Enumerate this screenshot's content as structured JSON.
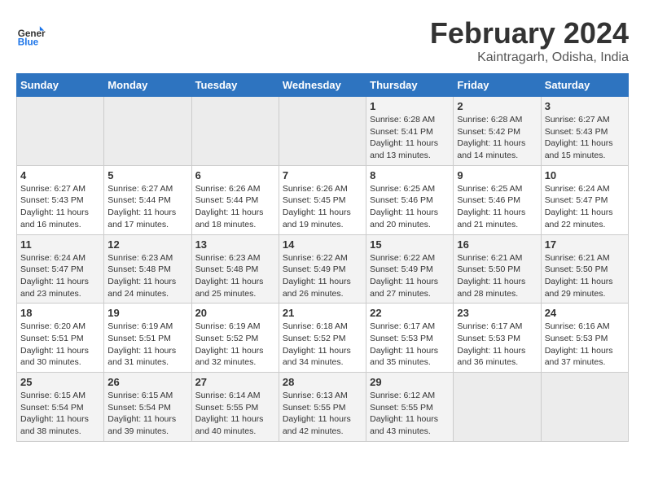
{
  "header": {
    "logo_line1": "General",
    "logo_line2": "Blue",
    "month": "February 2024",
    "location": "Kaintragarh, Odisha, India"
  },
  "days_of_week": [
    "Sunday",
    "Monday",
    "Tuesday",
    "Wednesday",
    "Thursday",
    "Friday",
    "Saturday"
  ],
  "weeks": [
    [
      {
        "day": "",
        "info": ""
      },
      {
        "day": "",
        "info": ""
      },
      {
        "day": "",
        "info": ""
      },
      {
        "day": "",
        "info": ""
      },
      {
        "day": "1",
        "info": "Sunrise: 6:28 AM\nSunset: 5:41 PM\nDaylight: 11 hours and 13 minutes."
      },
      {
        "day": "2",
        "info": "Sunrise: 6:28 AM\nSunset: 5:42 PM\nDaylight: 11 hours and 14 minutes."
      },
      {
        "day": "3",
        "info": "Sunrise: 6:27 AM\nSunset: 5:43 PM\nDaylight: 11 hours and 15 minutes."
      }
    ],
    [
      {
        "day": "4",
        "info": "Sunrise: 6:27 AM\nSunset: 5:43 PM\nDaylight: 11 hours and 16 minutes."
      },
      {
        "day": "5",
        "info": "Sunrise: 6:27 AM\nSunset: 5:44 PM\nDaylight: 11 hours and 17 minutes."
      },
      {
        "day": "6",
        "info": "Sunrise: 6:26 AM\nSunset: 5:44 PM\nDaylight: 11 hours and 18 minutes."
      },
      {
        "day": "7",
        "info": "Sunrise: 6:26 AM\nSunset: 5:45 PM\nDaylight: 11 hours and 19 minutes."
      },
      {
        "day": "8",
        "info": "Sunrise: 6:25 AM\nSunset: 5:46 PM\nDaylight: 11 hours and 20 minutes."
      },
      {
        "day": "9",
        "info": "Sunrise: 6:25 AM\nSunset: 5:46 PM\nDaylight: 11 hours and 21 minutes."
      },
      {
        "day": "10",
        "info": "Sunrise: 6:24 AM\nSunset: 5:47 PM\nDaylight: 11 hours and 22 minutes."
      }
    ],
    [
      {
        "day": "11",
        "info": "Sunrise: 6:24 AM\nSunset: 5:47 PM\nDaylight: 11 hours and 23 minutes."
      },
      {
        "day": "12",
        "info": "Sunrise: 6:23 AM\nSunset: 5:48 PM\nDaylight: 11 hours and 24 minutes."
      },
      {
        "day": "13",
        "info": "Sunrise: 6:23 AM\nSunset: 5:48 PM\nDaylight: 11 hours and 25 minutes."
      },
      {
        "day": "14",
        "info": "Sunrise: 6:22 AM\nSunset: 5:49 PM\nDaylight: 11 hours and 26 minutes."
      },
      {
        "day": "15",
        "info": "Sunrise: 6:22 AM\nSunset: 5:49 PM\nDaylight: 11 hours and 27 minutes."
      },
      {
        "day": "16",
        "info": "Sunrise: 6:21 AM\nSunset: 5:50 PM\nDaylight: 11 hours and 28 minutes."
      },
      {
        "day": "17",
        "info": "Sunrise: 6:21 AM\nSunset: 5:50 PM\nDaylight: 11 hours and 29 minutes."
      }
    ],
    [
      {
        "day": "18",
        "info": "Sunrise: 6:20 AM\nSunset: 5:51 PM\nDaylight: 11 hours and 30 minutes."
      },
      {
        "day": "19",
        "info": "Sunrise: 6:19 AM\nSunset: 5:51 PM\nDaylight: 11 hours and 31 minutes."
      },
      {
        "day": "20",
        "info": "Sunrise: 6:19 AM\nSunset: 5:52 PM\nDaylight: 11 hours and 32 minutes."
      },
      {
        "day": "21",
        "info": "Sunrise: 6:18 AM\nSunset: 5:52 PM\nDaylight: 11 hours and 34 minutes."
      },
      {
        "day": "22",
        "info": "Sunrise: 6:17 AM\nSunset: 5:53 PM\nDaylight: 11 hours and 35 minutes."
      },
      {
        "day": "23",
        "info": "Sunrise: 6:17 AM\nSunset: 5:53 PM\nDaylight: 11 hours and 36 minutes."
      },
      {
        "day": "24",
        "info": "Sunrise: 6:16 AM\nSunset: 5:53 PM\nDaylight: 11 hours and 37 minutes."
      }
    ],
    [
      {
        "day": "25",
        "info": "Sunrise: 6:15 AM\nSunset: 5:54 PM\nDaylight: 11 hours and 38 minutes."
      },
      {
        "day": "26",
        "info": "Sunrise: 6:15 AM\nSunset: 5:54 PM\nDaylight: 11 hours and 39 minutes."
      },
      {
        "day": "27",
        "info": "Sunrise: 6:14 AM\nSunset: 5:55 PM\nDaylight: 11 hours and 40 minutes."
      },
      {
        "day": "28",
        "info": "Sunrise: 6:13 AM\nSunset: 5:55 PM\nDaylight: 11 hours and 42 minutes."
      },
      {
        "day": "29",
        "info": "Sunrise: 6:12 AM\nSunset: 5:55 PM\nDaylight: 11 hours and 43 minutes."
      },
      {
        "day": "",
        "info": ""
      },
      {
        "day": "",
        "info": ""
      }
    ]
  ]
}
